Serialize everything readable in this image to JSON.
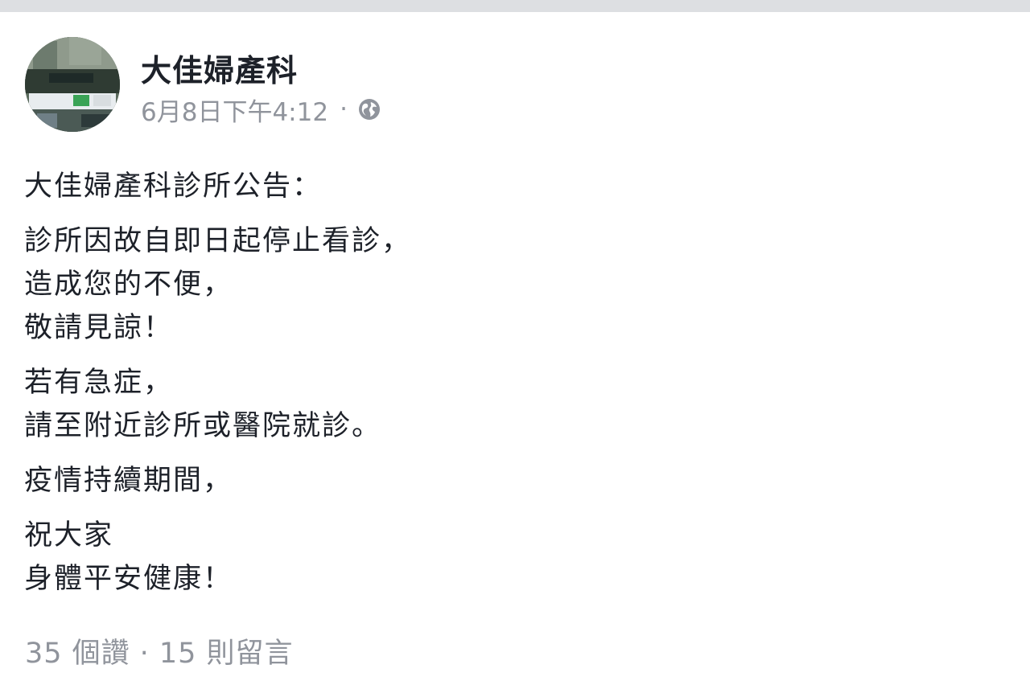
{
  "post": {
    "page_name": "大佳婦產科",
    "timestamp": "6月8日下午4:12",
    "separator": "·",
    "privacy_icon": "globe-icon",
    "paragraphs": [
      {
        "lines": [
          "大佳婦產科診所公告："
        ]
      },
      {
        "lines": [
          "診所因故自即日起停止看診，",
          "造成您的不便，",
          "敬請見諒！"
        ]
      },
      {
        "lines": [
          "若有急症，",
          "請至附近診所或醫院就診。"
        ]
      },
      {
        "lines": [
          "疫情持續期間，"
        ]
      },
      {
        "lines": [
          "祝大家",
          "身體平安健康！"
        ]
      }
    ],
    "reactions": {
      "likes_label": "35 個讚",
      "separator": "·",
      "comments_label": "15 則留言"
    }
  },
  "colors": {
    "top_strip": "#dddfe2",
    "text_primary": "#1d2129",
    "text_secondary": "#90949c"
  }
}
